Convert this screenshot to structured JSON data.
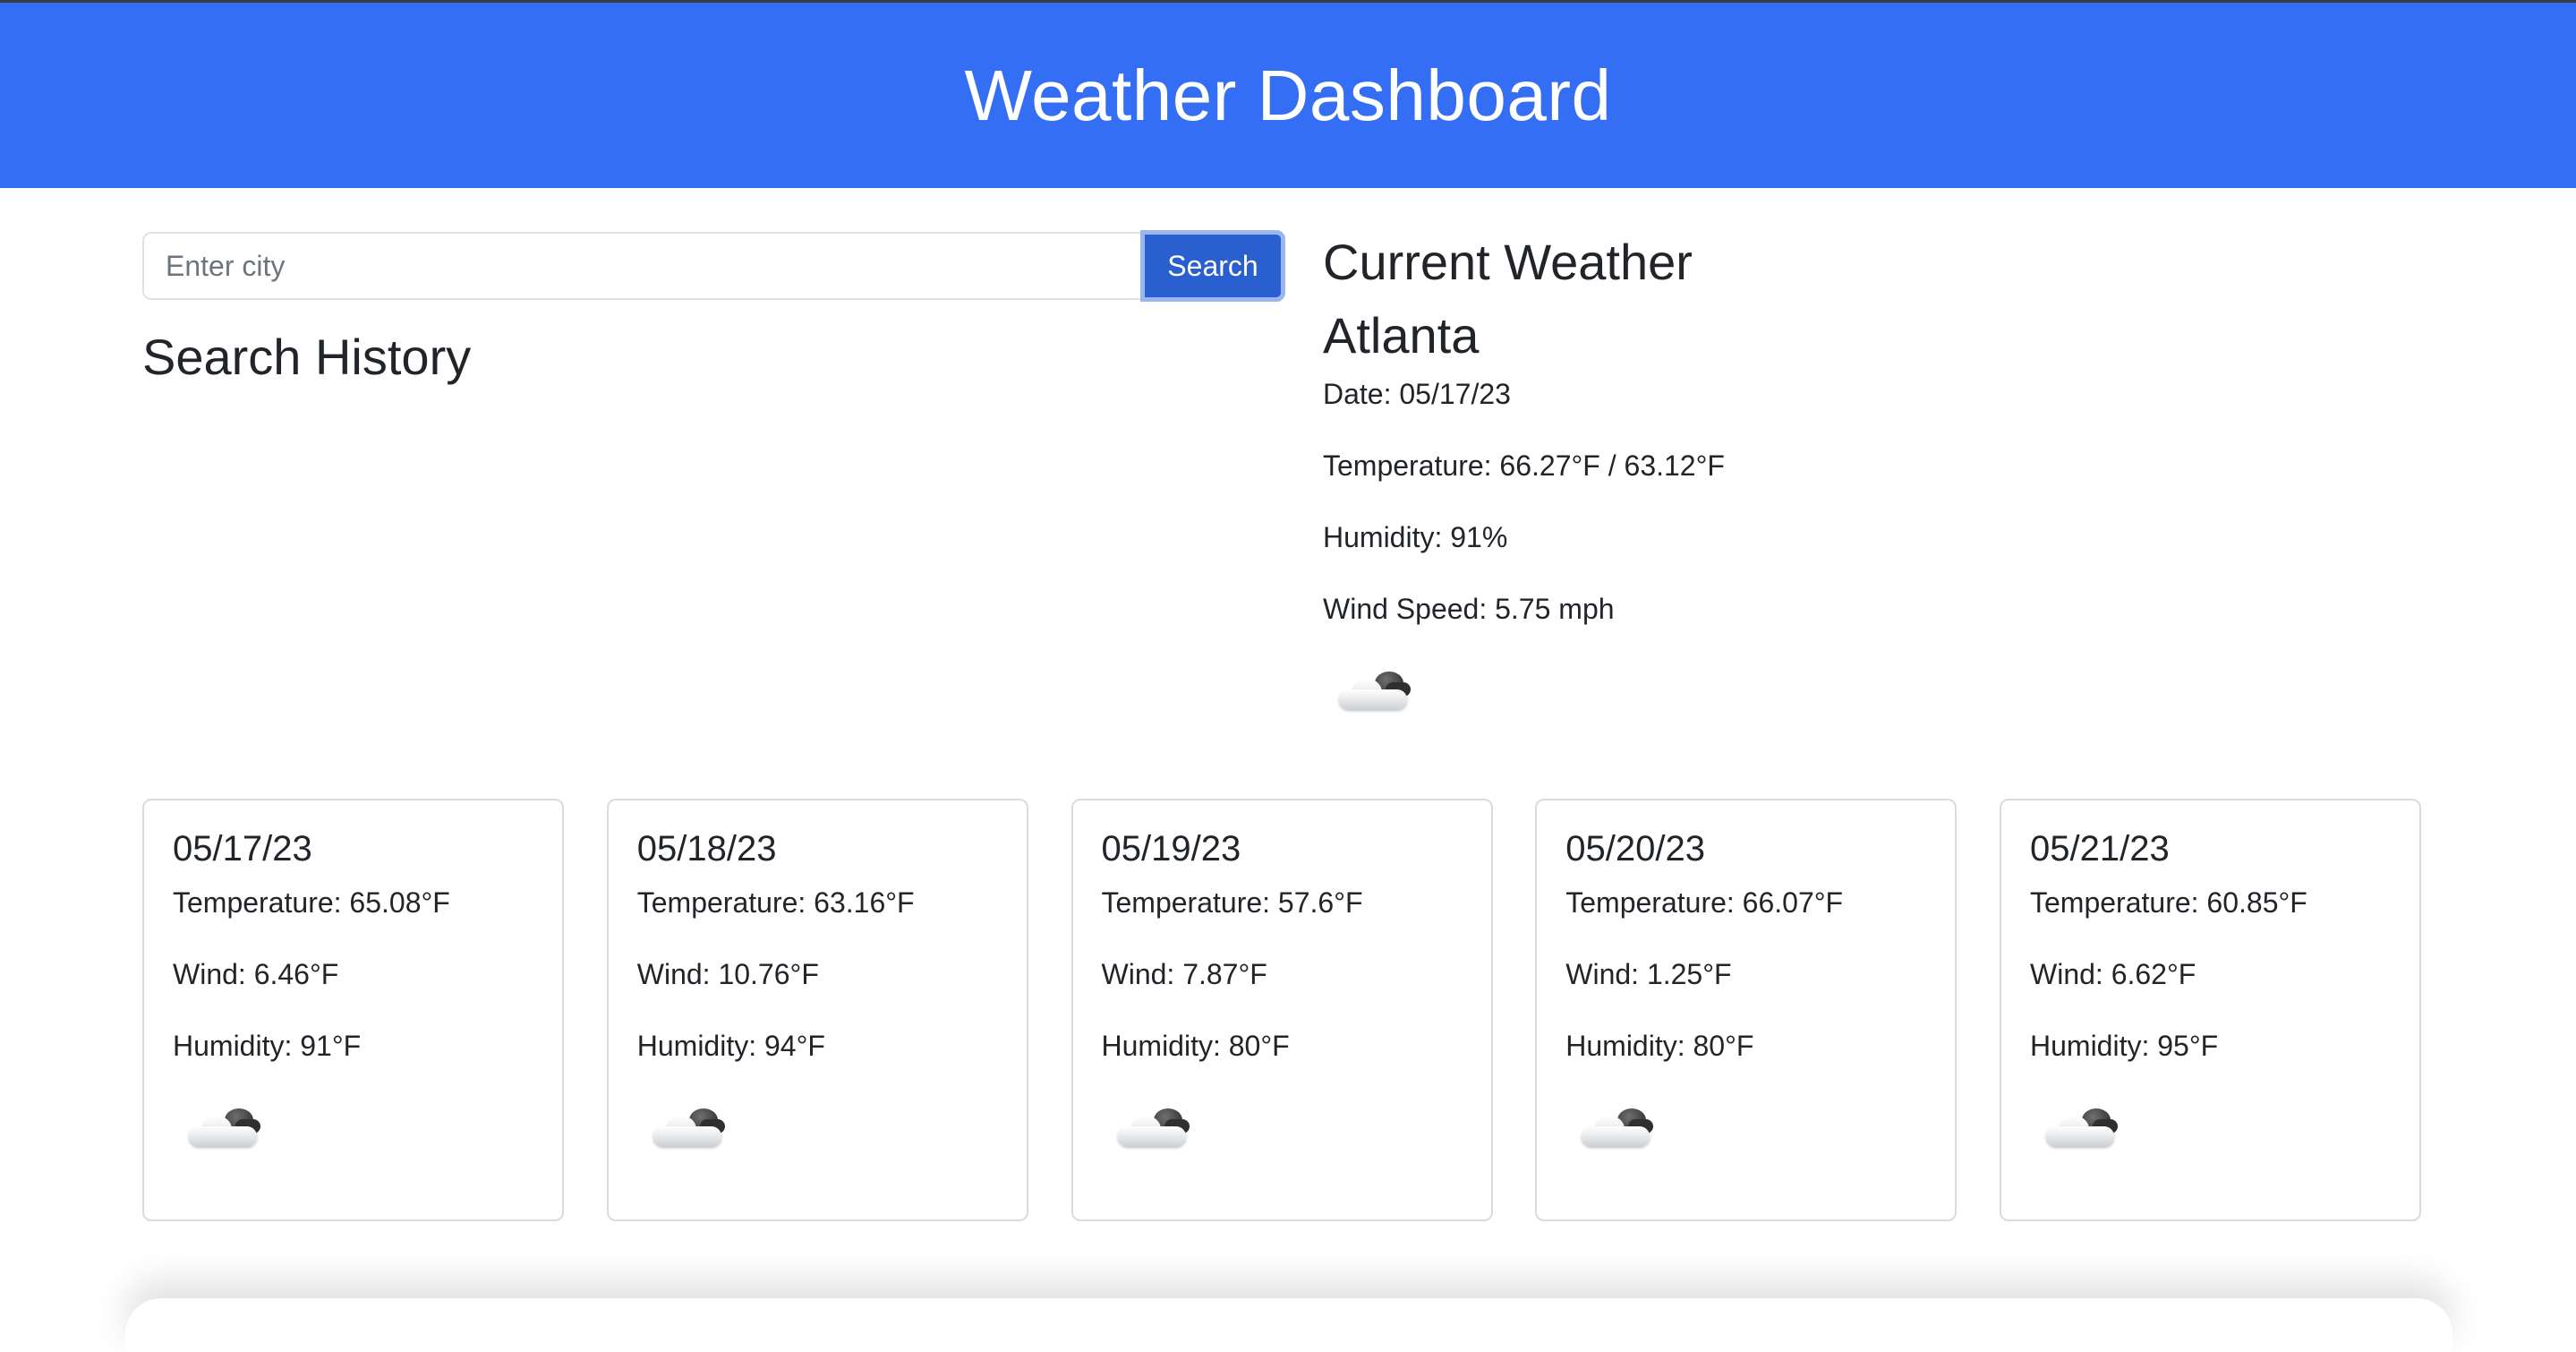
{
  "header": {
    "title": "Weather Dashboard"
  },
  "search": {
    "placeholder": "Enter city",
    "value": "",
    "button_label": "Search"
  },
  "history": {
    "title": "Search History",
    "items": []
  },
  "current": {
    "heading": "Current Weather",
    "city": "Atlanta",
    "date": "Date: 05/17/23",
    "temperature": "Temperature: 66.27°F / 63.12°F",
    "humidity": "Humidity: 91%",
    "wind": "Wind Speed: 5.75 mph",
    "icon": "cloudy-icon"
  },
  "forecast": [
    {
      "date": "05/17/23",
      "temperature": "Temperature: 65.08°F",
      "wind": "Wind: 6.46°F",
      "humidity": "Humidity: 91°F",
      "icon": "cloudy-icon"
    },
    {
      "date": "05/18/23",
      "temperature": "Temperature: 63.16°F",
      "wind": "Wind: 10.76°F",
      "humidity": "Humidity: 94°F",
      "icon": "cloudy-icon"
    },
    {
      "date": "05/19/23",
      "temperature": "Temperature: 57.6°F",
      "wind": "Wind: 7.87°F",
      "humidity": "Humidity: 80°F",
      "icon": "cloudy-icon"
    },
    {
      "date": "05/20/23",
      "temperature": "Temperature: 66.07°F",
      "wind": "Wind: 1.25°F",
      "humidity": "Humidity: 80°F",
      "icon": "cloudy-icon"
    },
    {
      "date": "05/21/23",
      "temperature": "Temperature: 60.85°F",
      "wind": "Wind: 6.62°F",
      "humidity": "Humidity: 95°F",
      "icon": "cloudy-icon"
    }
  ],
  "colors": {
    "header_bg": "#346ef5",
    "button_bg": "#2a5fd0"
  }
}
